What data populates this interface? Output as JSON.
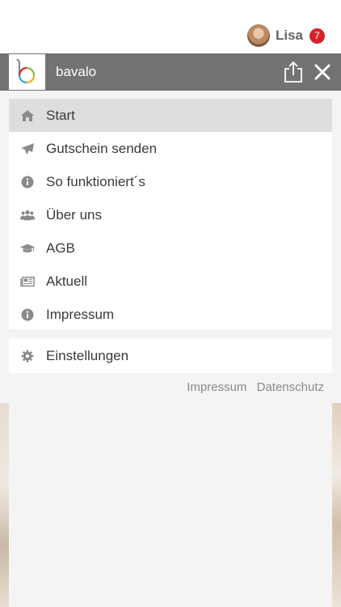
{
  "user": {
    "name": "Lisa",
    "notifications": "7"
  },
  "header": {
    "title": "bavalo"
  },
  "menu": {
    "items": [
      {
        "label": "Start",
        "icon": "home-icon"
      },
      {
        "label": "Gutschein senden",
        "icon": "paper-plane-icon"
      },
      {
        "label": "So funktioniert´s",
        "icon": "info-icon"
      },
      {
        "label": "Über uns",
        "icon": "users-icon"
      },
      {
        "label": "AGB",
        "icon": "graduation-cap-icon"
      },
      {
        "label": "Aktuell",
        "icon": "newspaper-icon"
      },
      {
        "label": "Impressum",
        "icon": "info-icon"
      }
    ],
    "settings": {
      "label": "Einstellungen",
      "icon": "gear-icon"
    }
  },
  "footer": {
    "impressum": "Impressum",
    "datenschutz": "Datenschutz"
  },
  "colors": {
    "header_bg": "#737373",
    "active_bg": "#dedede",
    "badge": "#d2232a",
    "icon": "#8a8a8a"
  }
}
